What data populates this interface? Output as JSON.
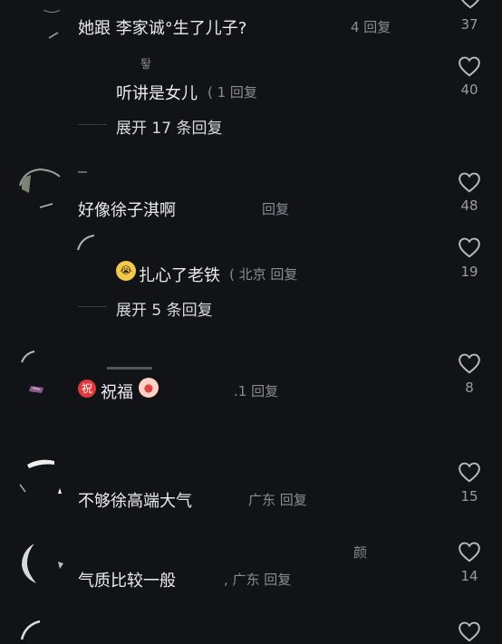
{
  "comments": [
    {
      "text": "她跟 李家诚°生了儿子?",
      "meta": "4 回复",
      "likes": "37"
    },
    {
      "username": "퇗",
      "text": "听讲是女儿",
      "meta": "( 1 回复",
      "likes": "40"
    },
    {
      "expand": "展开 17 条回复"
    },
    {
      "text": "好像徐子淇啊",
      "meta": "回复",
      "likes": "48"
    },
    {
      "text": "扎心了老铁",
      "meta": "( 北京 回复",
      "likes": "19",
      "emoji": "😭"
    },
    {
      "expand": "展开 5 条回复"
    },
    {
      "text": "祝福",
      "meta": ".1 回复",
      "likes": "8",
      "emoji": "祝"
    },
    {
      "text": "不够徐高端大气",
      "meta": "广东 回复",
      "likes": "15"
    },
    {
      "username": "颜",
      "text": "气质比较一般",
      "meta": ", 广东 回复",
      "likes": "14"
    }
  ]
}
